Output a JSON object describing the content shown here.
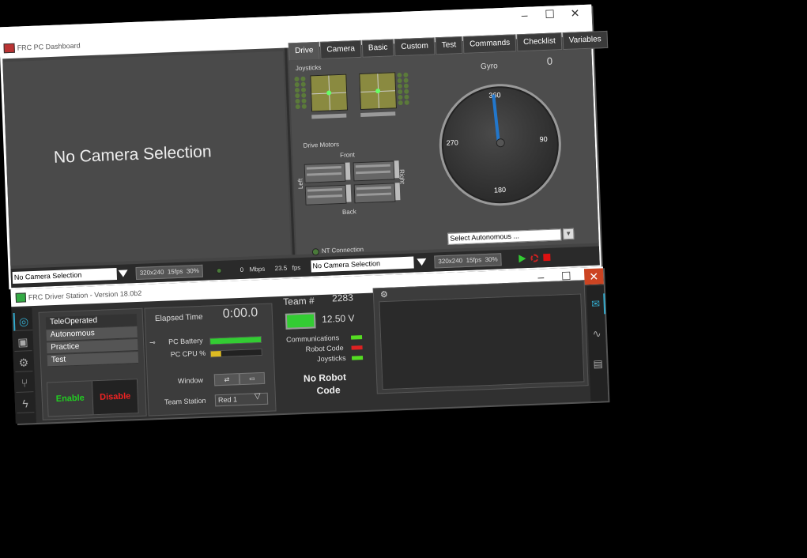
{
  "dashboard": {
    "title": "FRC PC Dashboard",
    "window_controls": [
      "–",
      "☐",
      "✕"
    ],
    "camera_placeholder": "No Camera Selection",
    "tabs": [
      "Drive",
      "Camera",
      "Basic",
      "Custom",
      "Test",
      "Commands",
      "Checklist",
      "Variables"
    ],
    "active_tab": "Drive",
    "drive": {
      "joysticks_label": "Joysticks",
      "drive_motors_label": "Drive Motors",
      "front": "Front",
      "back": "Back",
      "left": "Left",
      "right": "Right",
      "gyro_label": "Gyro",
      "gyro_value": "0",
      "gauge_ticks": {
        "top": "360",
        "left": "270",
        "right": "90",
        "bottom": "180"
      },
      "autonomous_select": "Select Autonomous ...",
      "nt_connection": "NT Connection"
    },
    "statusbar": {
      "left_camera": "No Camera Selection",
      "left_res": "320x240",
      "left_fps": "15fps",
      "left_pct": "30%",
      "mbps_value": "0",
      "mbps_unit": "Mbps",
      "fps_value": "23.5",
      "fps_unit": "fps",
      "right_camera": "No Camera Selection",
      "right_res": "320x240",
      "right_fps": "15fps",
      "right_pct": "30%"
    }
  },
  "driver_station": {
    "title": "FRC Driver Station - Version 18.0b2",
    "window_controls": [
      "–",
      "☐",
      "✕"
    ],
    "modes": [
      "TeleOperated",
      "Autonomous",
      "Practice",
      "Test"
    ],
    "active_mode": "TeleOperated",
    "enable": "Enable",
    "disable": "Disable",
    "elapsed_label": "Elapsed Time",
    "elapsed_value": "0:00.0",
    "pc_battery_label": "PC Battery",
    "pc_battery_level": 1.0,
    "pc_cpu_label": "PC CPU %",
    "pc_cpu_level": 0.2,
    "window_label": "Window",
    "team_station_label": "Team Station",
    "team_station_value": "Red 1",
    "team_label": "Team #",
    "team_number": "2283",
    "voltage": "12.50 V",
    "status": [
      {
        "label": "Communications",
        "color": "#55dd22"
      },
      {
        "label": "Robot Code",
        "color": "#dd2222"
      },
      {
        "label": "Joysticks",
        "color": "#55dd22"
      }
    ],
    "robot_status_line1": "No Robot",
    "robot_status_line2": "Code"
  }
}
